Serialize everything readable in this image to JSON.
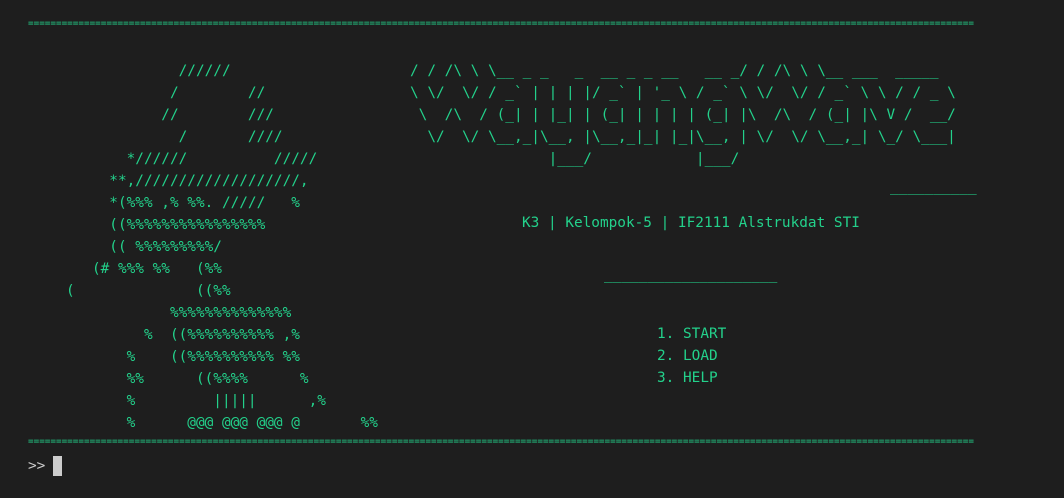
{
  "header_rule": "=========================================================================================================================================================================",
  "logo_ascii": "                //////          \n               /        //      \n              //        ///     \n                /       ////    \n          *//////          /////\n        **,///////////////////, \n        *(%%% ,% %%. /////   % \n        ((%%%%%%%%%%%%%%%%     \n        (( %%%%%%%%%/          \n      (# %%% %%   (%%          \n   (              ((%%         \n               %%%%%%%%%%%%%%  \n            %  ((%%%%%%%%%% ,% \n          %    ((%%%%%%%%%% %% \n          %%      ((%%%%      %\n          %         |||||      ,%\n          %      @@@ @@@ @@@ @       %%",
  "title_ascii": "/ / /\\ \\ \\__ _ _   _  __ _ _ __   __ _/ / /\\ \\ \\__ ___  _____\n\\ \\/  \\/ / _` | | | |/ _` | '_ \\ / _` \\ \\/  \\/ / _` \\ \\ / / _ \\\n \\  /\\  / (_| | |_| | (_| | | | | (_| |\\  /\\  / (_| |\\ V /  __/\n  \\/  \\/ \\__,_|\\__, |\\__,_|_| |_|\\__, | \\/  \\/ \\__,_| \\_/ \\___|\n                |___/            |___/",
  "short_rule": "__________",
  "subtitle": "K3 | Kelompok-5 | IF2111 Alstrukdat STI",
  "mid_rule": "____________________",
  "menu": [
    {
      "label": "1. START"
    },
    {
      "label": "2. LOAD"
    },
    {
      "label": "3. HELP"
    }
  ],
  "footer_rule": "=========================================================================================================================================================================",
  "prompt": ">>",
  "colors": {
    "background": "#1e1e1e",
    "text_green": "#23d18b",
    "prompt_text": "#cccccc"
  }
}
